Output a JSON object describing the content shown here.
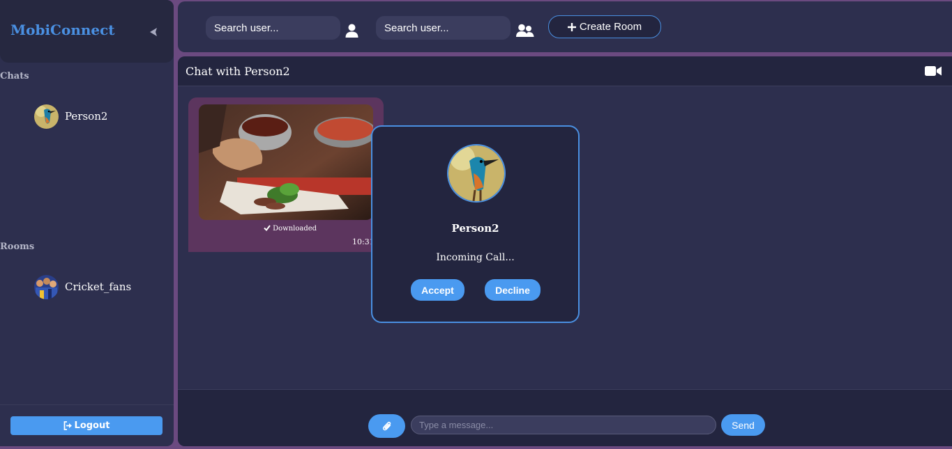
{
  "sidebar": {
    "brand": "MobiConnect",
    "chats_label": "Chats",
    "chats": [
      {
        "name": "Person2"
      }
    ],
    "rooms_label": "Rooms",
    "rooms": [
      {
        "name": "Cricket_fans"
      }
    ],
    "logout_label": "Logout"
  },
  "topbar": {
    "search_user_placeholder": "Search user...",
    "search_group_placeholder": "Search user...",
    "create_room_label": "Create Room"
  },
  "chat": {
    "title": "Chat with Person2",
    "message": {
      "status": "Downloaded",
      "time": "10:31 PM"
    },
    "input_placeholder": "Type a message...",
    "send_label": "Send"
  },
  "call_modal": {
    "caller": "Person2",
    "status": "Incoming Call...",
    "accept_label": "Accept",
    "decline_label": "Decline"
  },
  "colors": {
    "accent": "#4a90e2",
    "panel": "#2d2f4e",
    "dark_panel": "#23253f",
    "background": "#6b4a80",
    "bubble": "#5c355e"
  },
  "icons": {
    "collapse": "chevron-left-icon",
    "user_search": "user-icon",
    "group_search": "users-icon",
    "create_room": "plus-icon",
    "video_call": "video-camera-icon",
    "attach": "paperclip-icon",
    "logout": "sign-out-icon",
    "downloaded": "check-icon"
  }
}
